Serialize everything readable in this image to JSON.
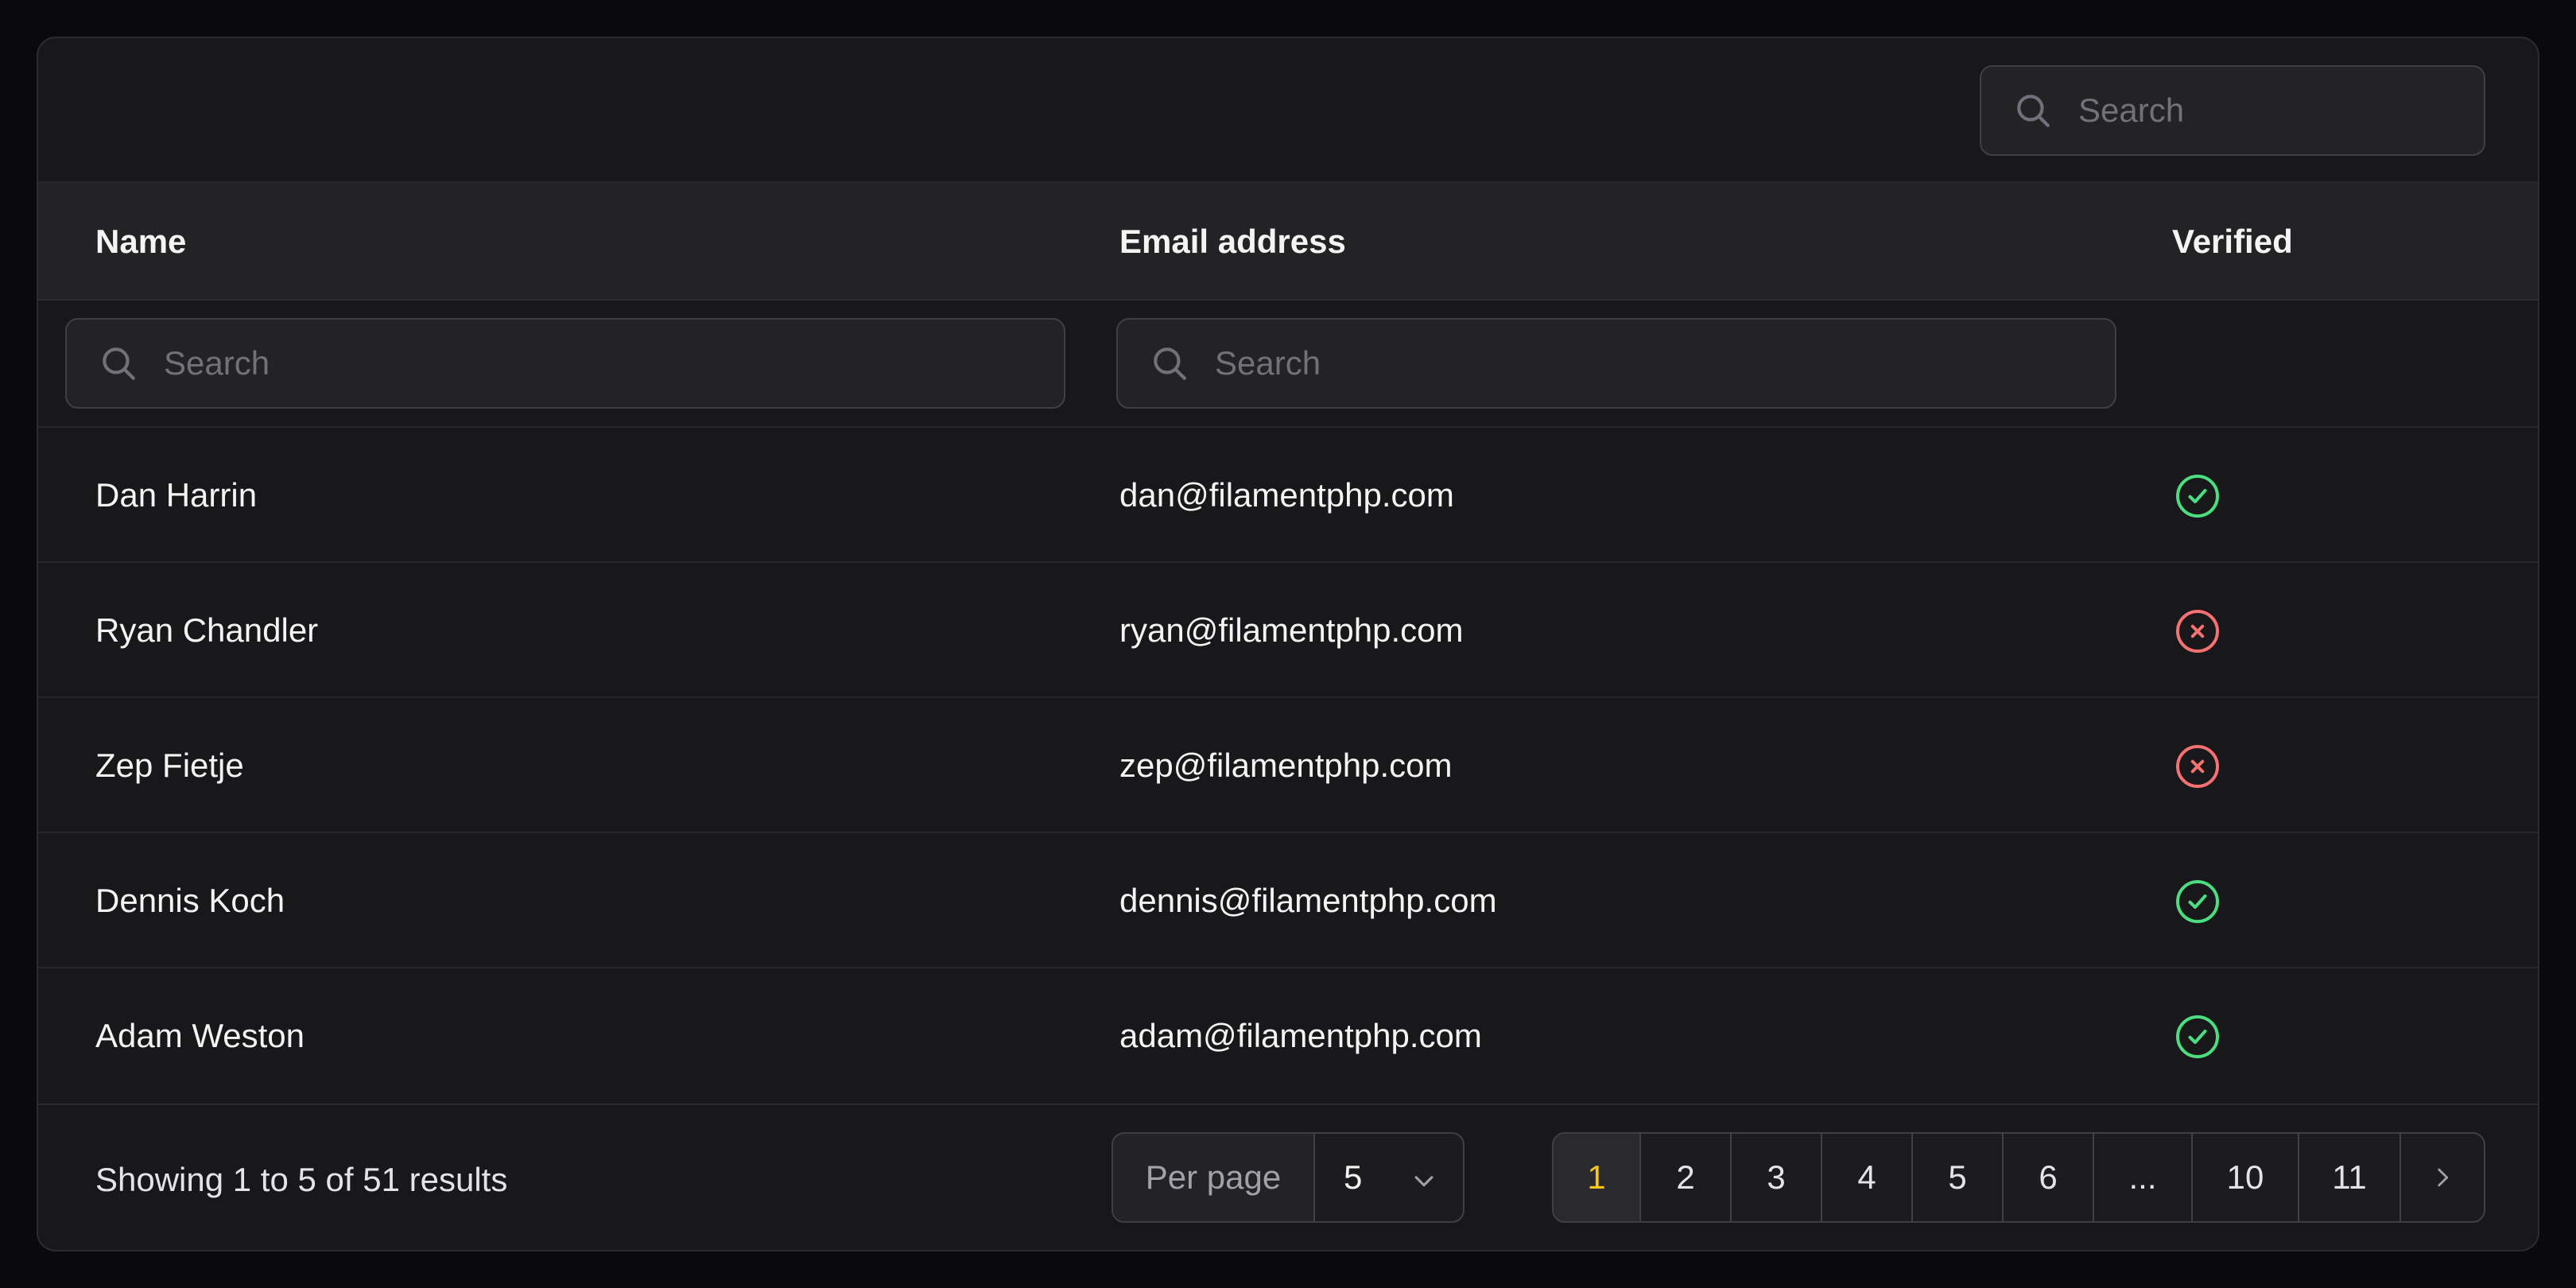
{
  "search": {
    "global_placeholder": "Search",
    "name_placeholder": "Search",
    "email_placeholder": "Search"
  },
  "columns": {
    "name": "Name",
    "email": "Email address",
    "verified": "Verified"
  },
  "rows": [
    {
      "name": "Dan Harrin",
      "email": "dan@filamentphp.com",
      "verified": true
    },
    {
      "name": "Ryan Chandler",
      "email": "ryan@filamentphp.com",
      "verified": false
    },
    {
      "name": "Zep Fietje",
      "email": "zep@filamentphp.com",
      "verified": false
    },
    {
      "name": "Dennis Koch",
      "email": "dennis@filamentphp.com",
      "verified": true
    },
    {
      "name": "Adam Weston",
      "email": "adam@filamentphp.com",
      "verified": true
    }
  ],
  "footer": {
    "summary": "Showing 1 to 5 of 51 results",
    "per_page_label": "Per page",
    "per_page_value": "5",
    "pages": [
      "1",
      "2",
      "3",
      "4",
      "5",
      "6",
      "...",
      "10",
      "11"
    ],
    "current_page": "1"
  },
  "icons": {
    "search": "search-icon",
    "verified_true": "check-circle-icon",
    "verified_false": "x-circle-icon",
    "chevron_down": "chevron-down-icon",
    "next": "chevron-right-icon"
  },
  "colors": {
    "verified_true": "#4ade80",
    "verified_false": "#f87171",
    "active_page": "#f5c518"
  }
}
